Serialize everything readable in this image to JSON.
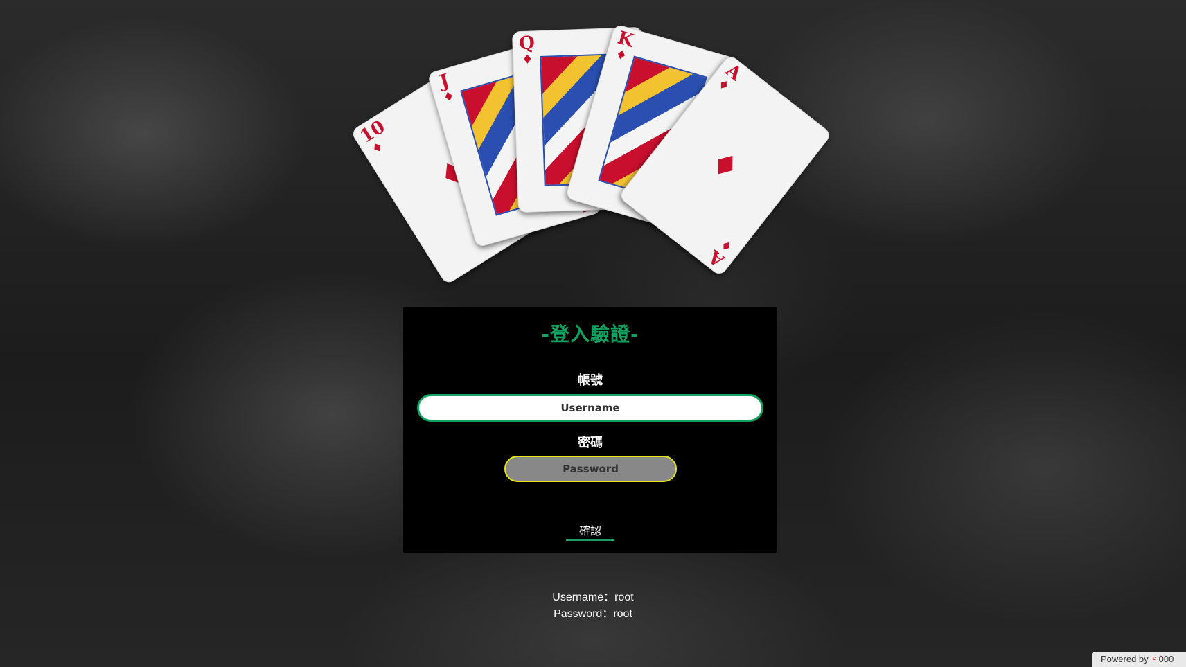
{
  "cards": [
    {
      "rank": "10",
      "suit": "♦",
      "face": false
    },
    {
      "rank": "J",
      "suit": "♦",
      "face": true
    },
    {
      "rank": "Q",
      "suit": "♦",
      "face": true
    },
    {
      "rank": "K",
      "suit": "♦",
      "face": true
    },
    {
      "rank": "A",
      "suit": "♦",
      "face": false
    }
  ],
  "login": {
    "title": "-登入驗證-",
    "username_label": "帳號",
    "username_placeholder": "Username",
    "password_label": "密碼",
    "password_placeholder": "Password",
    "confirm_label": "確認"
  },
  "hint": {
    "username": "Username：root",
    "password": "Password：root"
  },
  "badge": {
    "powered_by": "Powered by",
    "logo": "000"
  },
  "colors": {
    "accent": "#11a160",
    "password_border": "#e5e51a",
    "card_red": "#c8102e"
  }
}
